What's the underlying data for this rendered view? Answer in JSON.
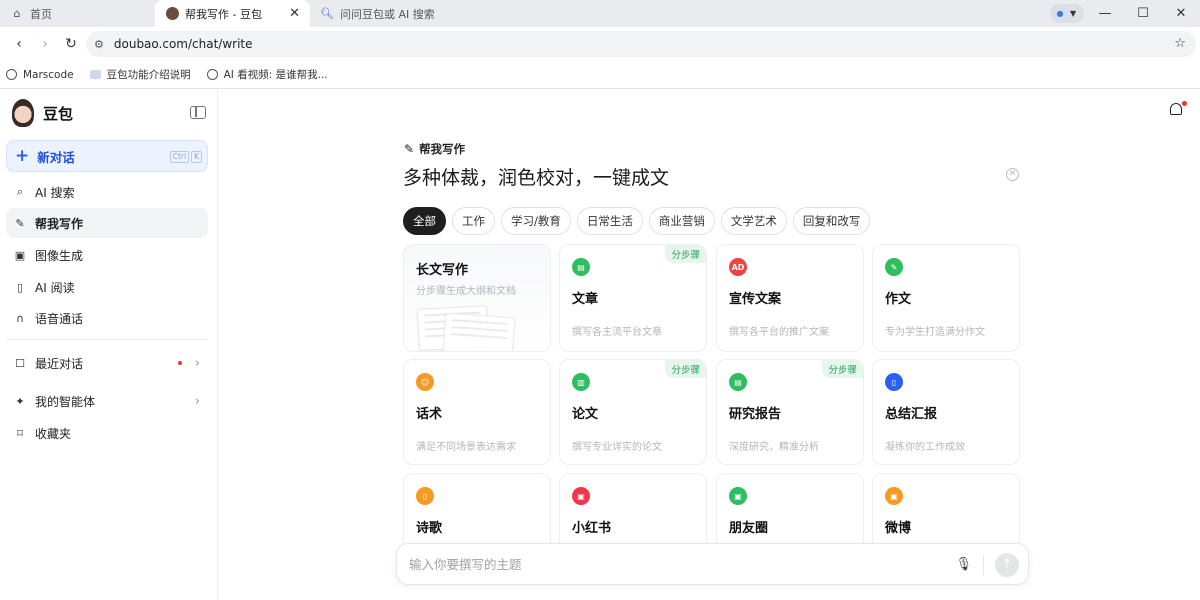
{
  "browser": {
    "tabs": [
      {
        "title": "首页"
      },
      {
        "title": "帮我写作 - 豆包"
      },
      {
        "title": "问问豆包或 AI 搜索"
      }
    ],
    "url": "doubao.com/chat/write",
    "bookmarks": [
      {
        "label": "Marscode"
      },
      {
        "label": "豆包功能介绍说明"
      },
      {
        "label": "AI 看视频: 是谁帮我..."
      }
    ],
    "window_controls": {
      "minimize": "—",
      "maximize": "☐",
      "close": "✕"
    }
  },
  "sidebar": {
    "brand": "豆包",
    "new_chat": {
      "label": "新对话",
      "shortcut": [
        "Ctrl",
        "K"
      ]
    },
    "items": [
      {
        "label": "AI 搜索",
        "icon": "search-spark-icon"
      },
      {
        "label": "帮我写作",
        "icon": "write-icon"
      },
      {
        "label": "图像生成",
        "icon": "image-icon"
      },
      {
        "label": "AI 阅读",
        "icon": "read-icon"
      },
      {
        "label": "语音通话",
        "icon": "headphones-icon"
      }
    ],
    "recent": {
      "label": "最近对话"
    },
    "agents": {
      "label": "我的智能体"
    },
    "favorites": {
      "label": "收藏夹"
    }
  },
  "main": {
    "section_label": "帮我写作",
    "headline": "多种体裁，润色校对，一键成文",
    "chips": [
      "全部",
      "工作",
      "学习/教育",
      "日常生活",
      "商业营销",
      "文学艺术",
      "回复和改写"
    ],
    "selected_chip": "全部",
    "feature_card": {
      "title": "长文写作",
      "desc": "分步骤生成大纲和文档"
    },
    "cards": [
      {
        "title": "文章",
        "desc": "撰写各主流平台文章",
        "badge": "分步骤",
        "color": "#2ebd5f",
        "icon": "doc-icon"
      },
      {
        "title": "宣传文案",
        "desc": "撰写各平台的推广文案",
        "badge": "",
        "color": "#f04444",
        "icon": "ad-icon",
        "icon_text": "AD"
      },
      {
        "title": "作文",
        "desc": "专为学生打造满分作文",
        "badge": "",
        "color": "#2ebd5f",
        "icon": "pen-icon"
      },
      {
        "title": "话术",
        "desc": "满足不同场景表达需求",
        "badge": "",
        "color": "#f59a23",
        "icon": "people-icon"
      },
      {
        "title": "论文",
        "desc": "撰写专业详实的论文",
        "badge": "分步骤",
        "color": "#2ebd5f",
        "icon": "chart-icon"
      },
      {
        "title": "研究报告",
        "desc": "深度研究，精准分析",
        "badge": "分步骤",
        "color": "#2ebd5f",
        "icon": "report-icon"
      },
      {
        "title": "总结汇报",
        "desc": "凝练你的工作成效",
        "badge": "",
        "color": "#2a62f0",
        "icon": "summary-icon"
      },
      {
        "title": "诗歌",
        "desc": "",
        "badge": "",
        "color": "#f59a23",
        "icon": "poem-icon"
      },
      {
        "title": "小红书",
        "desc": "",
        "badge": "",
        "color": "#f0384a",
        "icon": "xiaohongshu-icon"
      },
      {
        "title": "朋友圈",
        "desc": "",
        "badge": "",
        "color": "#2ebd5f",
        "icon": "moments-icon"
      },
      {
        "title": "微博",
        "desc": "",
        "badge": "",
        "color": "#f59a23",
        "icon": "weibo-icon"
      }
    ],
    "input": {
      "placeholder": "输入你要撰写的主题"
    }
  }
}
